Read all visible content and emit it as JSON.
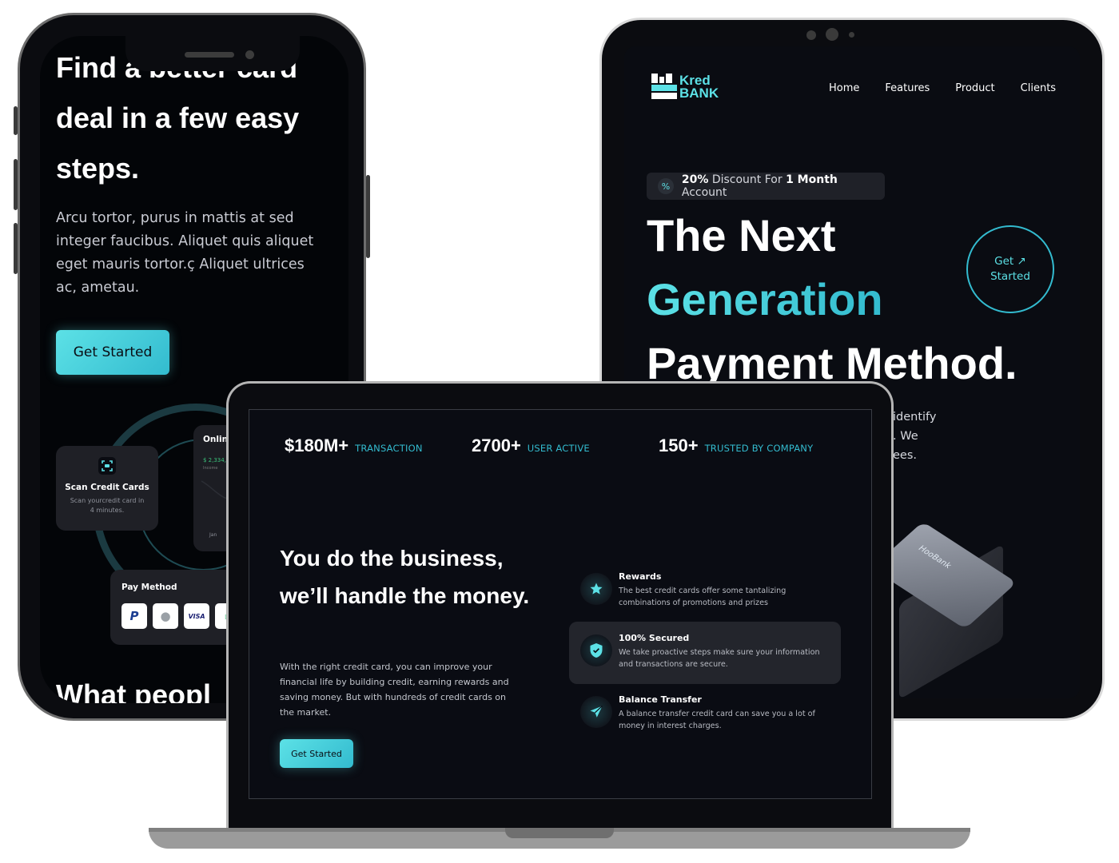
{
  "phone": {
    "hero_title": "Find a better card deal in a few easy steps.",
    "hero_description": "Arcu tortor, purus in mattis at sed integer faucibus. Aliquet quis aliquet eget mauris tortor.ç Aliquet ultrices ac, ametau.",
    "cta_label": "Get Started",
    "scan_card": {
      "title": "Scan Credit Cards",
      "subtitle": "Scan yourcredit card in 4 minutes."
    },
    "online_card": {
      "title": "Online",
      "amount": "$ 2,334,",
      "sub": "Income",
      "axis_label": "Jan"
    },
    "pay_method": {
      "title": "Pay Method",
      "methods": [
        "PayPal",
        "Apple",
        "VISA",
        "Card"
      ]
    },
    "next_section_title": "What peopl"
  },
  "tablet": {
    "brand": {
      "line1": "Kred",
      "line2": "BANK"
    },
    "nav": [
      "Home",
      "Features",
      "Product",
      "Clients"
    ],
    "discount": {
      "bold1": "20%",
      "text1": " Discount For ",
      "bold2": "1 Month",
      "text2": " Account"
    },
    "headline": {
      "line1": "The Next",
      "line2": "Generation",
      "line3": "Payment Method."
    },
    "get_started": {
      "line1": "Get",
      "line2": "Started",
      "arrow": "↗"
    },
    "snippets": [
      "identify",
      ". We",
      "ees."
    ],
    "card_brand": "HooBank"
  },
  "laptop": {
    "stats": [
      {
        "value": "$180M+",
        "label": "TRANSACTION"
      },
      {
        "value": "2700+",
        "label": "USER ACTIVE"
      },
      {
        "value": "150+",
        "label": "TRUSTED BY COMPANY"
      }
    ],
    "heading": "You do the business, we’ll handle the money.",
    "paragraph": "With the right credit card, you can improve your financial life by building credit, earning rewards and saving money. But with hundreds of credit cards on the market.",
    "cta_label": "Get Started",
    "features": [
      {
        "icon": "star-icon",
        "title": "Rewards",
        "description": "The best credit cards offer some tantalizing combinations of promotions and prizes"
      },
      {
        "icon": "shield-icon",
        "title": "100% Secured",
        "description": "We take proactive steps make sure your information and transactions are secure."
      },
      {
        "icon": "send-icon",
        "title": "Balance Transfer",
        "description": "A balance transfer credit card can save you a lot of money in interest charges."
      }
    ]
  },
  "colors": {
    "accent": "#5ce1e6",
    "accent_dark": "#33bbcf",
    "background": "#0a0c12"
  }
}
